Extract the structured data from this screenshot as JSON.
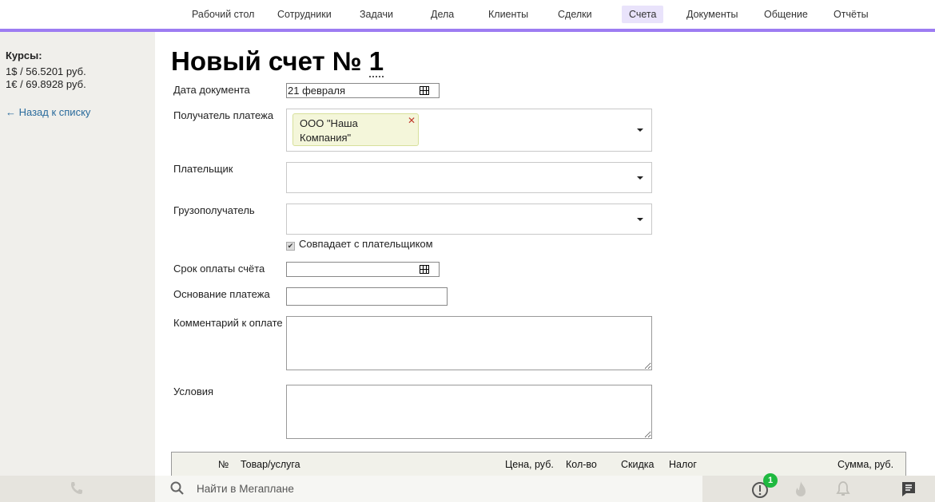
{
  "nav": {
    "items": [
      "Рабочий стол",
      "Сотрудники",
      "Задачи",
      "Дела",
      "Клиенты",
      "Сделки",
      "Счета",
      "Документы",
      "Общение",
      "Отчёты"
    ],
    "active": "Счета"
  },
  "sidebar": {
    "rates_title": "Курсы:",
    "rate_usd": "1$ / 56.5201 руб.",
    "rate_eur": "1€ / 69.8928 руб.",
    "back": "← Назад к списку"
  },
  "page": {
    "title": "Новый счет №",
    "number": "1"
  },
  "form": {
    "doc_date_label": "Дата документа",
    "doc_date_value": "21 февраля",
    "recipient_label": "Получатель платежа",
    "recipient_value": "ООО \"Наша Компания\"",
    "payer_label": "Плательщик",
    "consignee_label": "Грузополучатель",
    "same_as_payer": "Совпадает с плательщиком",
    "due_label": "Срок оплаты счёта",
    "basis_label": "Основание платежа",
    "comment_label": "Комментарий к оплате",
    "terms_label": "Условия"
  },
  "table": {
    "columns": [
      "№",
      "Товар/услуга",
      "Цена, руб.",
      "Кол-во",
      "Скидка",
      "Налог",
      "Сумма, руб."
    ]
  },
  "bottom": {
    "search_placeholder": "Найти в Мегаплане",
    "alerts_count": "1"
  },
  "colors": {
    "accent": "#9d7cf2",
    "badge": "#1fb940"
  }
}
